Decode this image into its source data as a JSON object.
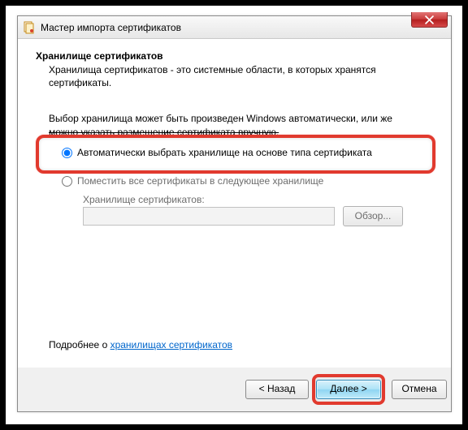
{
  "window": {
    "title": "Мастер импорта сертификатов"
  },
  "section": {
    "title": "Хранилище сертификатов",
    "desc": "Хранилища сертификатов - это системные области, в которых хранятся сертификаты."
  },
  "prompt": {
    "line1": "Выбор хранилища может быть произведен Windows автоматически, или же",
    "line2_struck": "можно указать размещение сертификата вручную."
  },
  "options": {
    "auto": "Автоматически выбрать хранилище на основе типа сертификата",
    "manual": "Поместить все сертификаты в следующее хранилище",
    "store_label": "Хранилище сертификатов:",
    "browse": "Обзор..."
  },
  "more": {
    "prefix": "Подробнее о ",
    "link": "хранилищах сертификатов"
  },
  "footer": {
    "back": "< Назад",
    "next": "Далее >",
    "cancel": "Отмена"
  }
}
